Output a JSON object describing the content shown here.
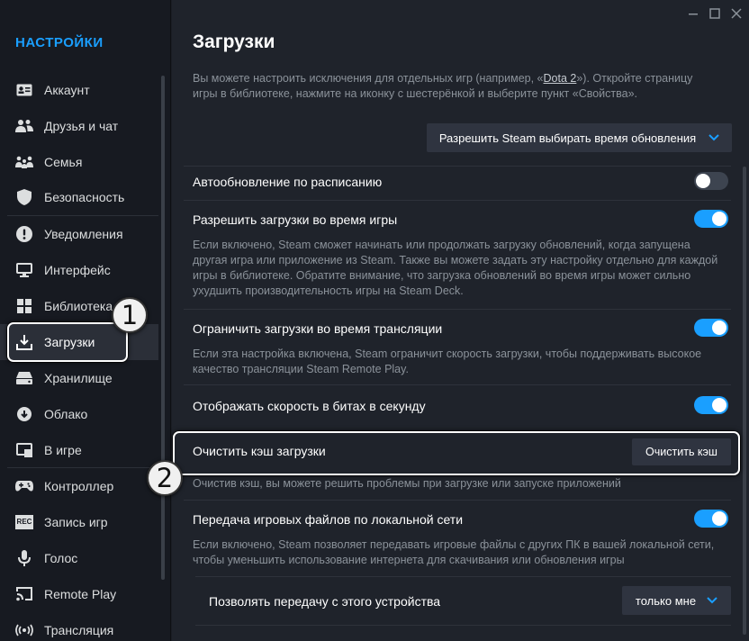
{
  "sidebar": {
    "title": "НАСТРОЙКИ",
    "items": [
      {
        "label": "Аккаунт",
        "icon": "account-card-icon"
      },
      {
        "label": "Друзья и чат",
        "icon": "friends-icon"
      },
      {
        "label": "Семья",
        "icon": "family-icon"
      },
      {
        "label": "Безопасность",
        "icon": "shield-icon"
      },
      {
        "label": "Уведомления",
        "icon": "alert-icon"
      },
      {
        "label": "Интерфейс",
        "icon": "monitor-icon"
      },
      {
        "label": "Библиотека",
        "icon": "library-grid-icon"
      },
      {
        "label": "Загрузки",
        "icon": "download-icon",
        "active": true
      },
      {
        "label": "Хранилище",
        "icon": "storage-drive-icon"
      },
      {
        "label": "Облако",
        "icon": "cloud-icon"
      },
      {
        "label": "В игре",
        "icon": "in-game-icon"
      },
      {
        "label": "Контроллер",
        "icon": "gamepad-icon"
      },
      {
        "label": "Запись игр",
        "icon": "rec-icon"
      },
      {
        "label": "Голос",
        "icon": "microphone-icon"
      },
      {
        "label": "Remote Play",
        "icon": "cast-icon"
      },
      {
        "label": "Трансляция",
        "icon": "broadcast-icon"
      }
    ]
  },
  "rec_icon_text": "REC",
  "annotations": {
    "step1": "1",
    "step2": "2"
  },
  "main": {
    "title": "Загрузки",
    "intro_before": "Вы можете настроить исключения для отдельных игр (например, «",
    "intro_link": "Dota 2",
    "intro_after": "»). Откройте страницу игры в библиотеке, нажмите на иконку с шестерёнкой и выберите пункт «Свойства».",
    "update_dropdown": "Разрешить Steam выбирать время обновления",
    "settings": {
      "scheduled": {
        "title": "Автообновление по расписанию",
        "enabled": false
      },
      "during_game": {
        "title": "Разрешить загрузки во время игры",
        "enabled": true,
        "desc": "Если включено, Steam сможет начинать или продолжать загрузку обновлений, когда запущена другая игра или приложение из Steam. Также вы можете задать эту настройку отдельно для каждой игры в библиотеке. Обратите внимание, что загрузка обновлений во время игры может сильно ухудшить производительность игры на Steam Deck."
      },
      "limit_streaming": {
        "title": "Ограничить загрузки во время трансляции",
        "enabled": true,
        "desc": "Если эта настройка включена, Steam ограничит скорость загрузки, чтобы поддерживать высокое качество трансляции Steam Remote Play."
      },
      "bits": {
        "title": "Отображать скорость в битах в секунду",
        "enabled": true
      },
      "clear_cache": {
        "title": "Очистить кэш загрузки",
        "button": "Очистить кэш",
        "desc": "Очистив кэш, вы можете решить проблемы при загрузке или запуске приложений"
      },
      "lan": {
        "title": "Передача игровых файлов по локальной сети",
        "enabled": true,
        "desc": "Если включено, Steam позволяет передавать игровые файлы с других ПК в вашей локальной сети, чтобы уменьшить использование интернета для скачивания или обновления игры"
      },
      "share_from_device": {
        "title": "Позволять передачу с этого устройства",
        "value": "только мне"
      }
    }
  },
  "colors": {
    "accent": "#1a9fff",
    "sidebar_bg": "#171a21",
    "main_bg": "#1f232b"
  }
}
